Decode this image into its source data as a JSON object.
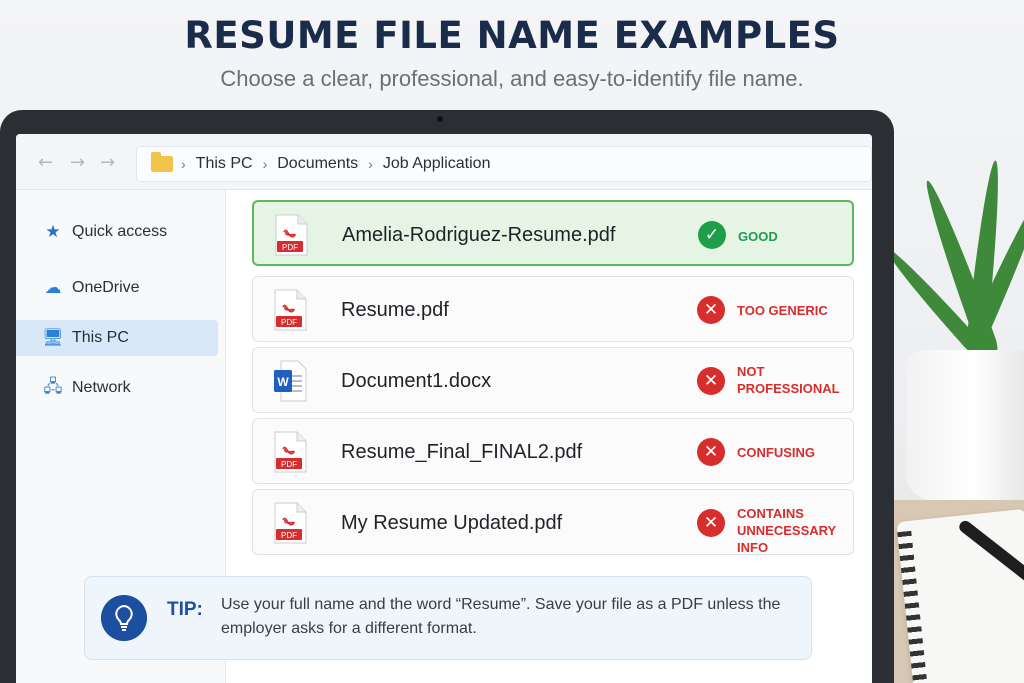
{
  "header": {
    "title": "RESUME FILE NAME EXAMPLES",
    "subtitle": "Choose a clear, professional, and easy-to-identify file name."
  },
  "explorer": {
    "nav": {
      "back": "←",
      "forward": "→",
      "forward2": "→"
    },
    "breadcrumb": [
      "This PC",
      "Documents",
      "Job Application"
    ],
    "breadcrumb_separator": "›",
    "sidebar": [
      {
        "label": "Quick access",
        "icon": "star-icon",
        "icon_glyph": "★",
        "active": false
      },
      {
        "label": "OneDrive",
        "icon": "cloud-icon",
        "icon_glyph": "☁",
        "active": false
      },
      {
        "label": "This PC",
        "icon": "monitor-icon",
        "icon_glyph": "🖥",
        "active": true
      },
      {
        "label": "Network",
        "icon": "network-icon",
        "icon_glyph": "🖧",
        "active": false
      }
    ],
    "files": [
      {
        "name": "Amelia-Rodriguez-Resume.pdf",
        "type": "pdf",
        "type_label": "PDF",
        "status": "good",
        "status_label": "GOOD"
      },
      {
        "name": "Resume.pdf",
        "type": "pdf",
        "type_label": "PDF",
        "status": "bad",
        "status_label": "TOO GENERIC"
      },
      {
        "name": "Document1.docx",
        "type": "word",
        "type_label": "W",
        "status": "bad",
        "status_label": "NOT\nPROFESSIONAL"
      },
      {
        "name": "Resume_Final_FINAL2.pdf",
        "type": "pdf",
        "type_label": "PDF",
        "status": "bad",
        "status_label": "CONFUSING"
      },
      {
        "name": "My Resume Updated.pdf",
        "type": "pdf",
        "type_label": "PDF",
        "status": "bad",
        "status_label": "CONTAINS\nUNNECESSARY INFO"
      }
    ]
  },
  "tip": {
    "label": "TIP:",
    "text": "Use your full name and the word “Resume”. Save your file as a PDF unless the employer asks for a different format."
  },
  "colors": {
    "good": "#1e9e4a",
    "bad": "#d62d2d",
    "accent": "#1d4fa0",
    "title": "#1b2b4a"
  }
}
